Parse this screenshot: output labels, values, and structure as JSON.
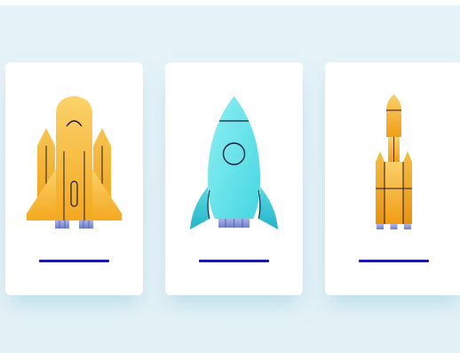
{
  "cards": [
    {
      "icon": "space-shuttle-icon",
      "label": ""
    },
    {
      "icon": "classic-rocket-icon",
      "label": ""
    },
    {
      "icon": "launch-vehicle-icon",
      "label": ""
    }
  ],
  "colors": {
    "background": "#e4f2f7",
    "card": "#ffffff",
    "underline": "#1a1aa8",
    "shuttle_body": "#f7b93d",
    "rocket_body": "#6ee6ec",
    "outline": "#1b1b3a"
  }
}
